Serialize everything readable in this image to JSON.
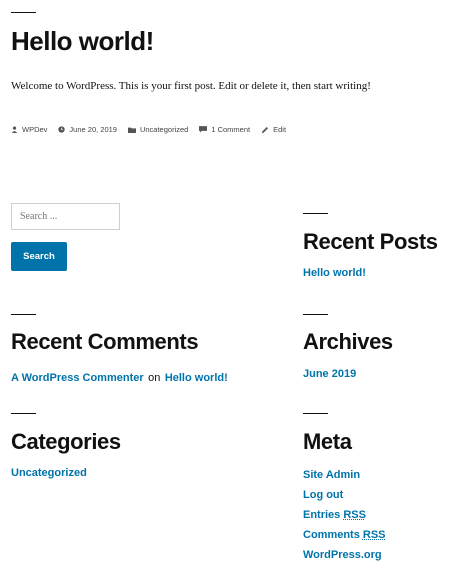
{
  "post": {
    "title": "Hello world!",
    "body": "Welcome to WordPress. This is your first post. Edit or delete it, then start writing!",
    "meta": {
      "author": "WPDev",
      "date": "June 20, 2019",
      "category": "Uncategorized",
      "comments": "1 Comment",
      "edit": "Edit"
    }
  },
  "search": {
    "placeholder": "Search ...",
    "button_label": "Search"
  },
  "recent_posts": {
    "title": "Recent Posts",
    "items": [
      "Hello world!"
    ]
  },
  "recent_comments": {
    "title": "Recent Comments",
    "author": "A WordPress Commenter",
    "connector": "on",
    "post": "Hello world!"
  },
  "archives": {
    "title": "Archives",
    "items": [
      "June 2019"
    ]
  },
  "categories": {
    "title": "Categories",
    "items": [
      "Uncategorized"
    ]
  },
  "meta_widget": {
    "title": "Meta",
    "site_admin": "Site Admin",
    "log_out": "Log out",
    "entries_prefix": "Entries",
    "comments_prefix": "Comments",
    "rss": "RSS",
    "wordpress_org": "WordPress.org"
  },
  "colors": {
    "accent": "#0073aa",
    "text": "#111111"
  }
}
